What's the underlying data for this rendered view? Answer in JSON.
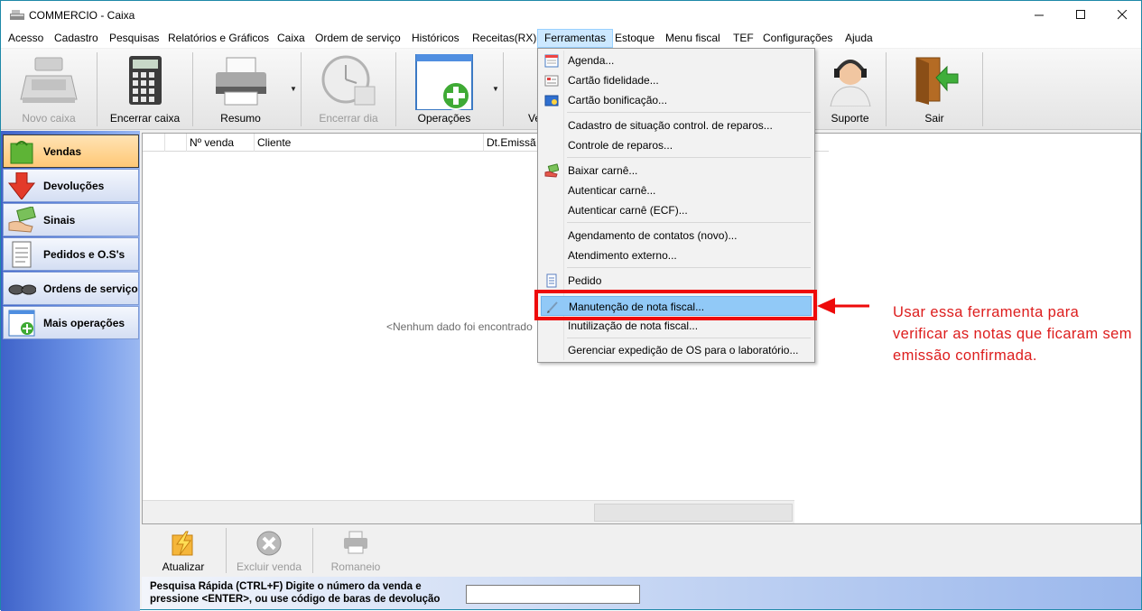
{
  "window": {
    "title": "COMMERCIO - Caixa"
  },
  "menubar": [
    "Acesso",
    "Cadastro",
    "Pesquisas",
    "Relatórios e Gráficos",
    "Caixa",
    "Ordem de serviço",
    "Históricos",
    "Receitas(RX)",
    "Ferramentas",
    "Estoque",
    "Menu fiscal",
    "TEF",
    "Configurações",
    "Ajuda"
  ],
  "toolbar": {
    "novo_caixa": "Novo caixa",
    "encerrar_caixa": "Encerrar caixa",
    "resumo": "Resumo",
    "encerrar_dia": "Encerrar dia",
    "operacoes": "Operações",
    "ve": "Ve",
    "suporte": "Suporte",
    "sair": "Sair"
  },
  "sidebar": [
    "Vendas",
    "Devoluções",
    "Sinais",
    "Pedidos e O.S's",
    "Ordens de serviço",
    "Mais operações"
  ],
  "grid": {
    "columns": [
      "Nº venda",
      "Cliente",
      "Dt.Emissã"
    ],
    "empty_message": "<Nenhum dado foi encontrado"
  },
  "bottom": {
    "atualizar": "Atualizar",
    "excluir_venda": "Excluir venda",
    "romaneio": "Romaneio"
  },
  "quick_search": {
    "label": "Pesquisa Rápida (CTRL+F) Digite o número da venda e pressione <ENTER>, ou use código de baras de devolução",
    "value": ""
  },
  "dropdown": [
    {
      "label": "Agenda...",
      "icon": "calendar-icon"
    },
    {
      "label": "Cartão fidelidade...",
      "icon": "card-icon"
    },
    {
      "label": "Cartão bonificação...",
      "icon": "bonus-card-icon"
    },
    {
      "label": "Cadastro de situação control. de reparos..."
    },
    {
      "label": "Controle de reparos..."
    },
    {
      "label": "Baixar carnê...",
      "icon": "payment-icon"
    },
    {
      "label": "Autenticar carnê..."
    },
    {
      "label": "Autenticar carnê (ECF)..."
    },
    {
      "label": "Agendamento de contatos (novo)..."
    },
    {
      "label": "Atendimento externo..."
    },
    {
      "label": "Pedido",
      "icon": "document-icon"
    },
    {
      "label": "Manutenção de nota fiscal...",
      "icon": "pencil-icon"
    },
    {
      "label": "Inutilização de nota fiscal..."
    },
    {
      "label": "Gerenciar expedição de OS para o laboratório..."
    }
  ],
  "annotation": {
    "text": "Usar essa ferramenta para verificar as notas que ficaram sem emissão confirmada.",
    "color": "#dd1d1d"
  }
}
